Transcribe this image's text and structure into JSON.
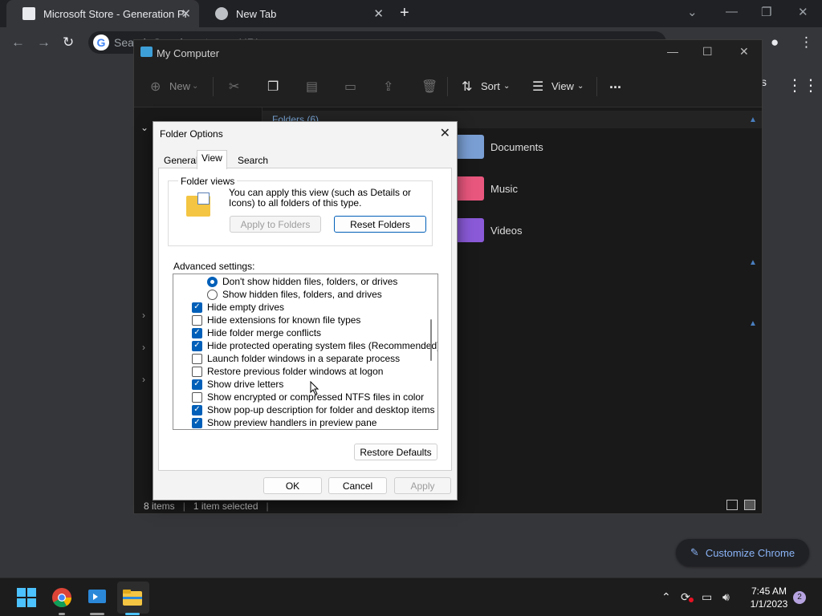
{
  "chrome": {
    "tabs": [
      {
        "title": "Microsoft Store - Generation Proj",
        "active": true
      },
      {
        "title": "New Tab",
        "active": false
      }
    ],
    "omnibox_placeholder": "Search Google or type a URL",
    "customize_label": "Customize Chrome",
    "partial_text": "s"
  },
  "explorer": {
    "title": "My Computer",
    "toolbar": {
      "new_label": "New",
      "sort_label": "Sort",
      "view_label": "View",
      "more_label": "..."
    },
    "folders_header": "Folders (6)",
    "items": [
      {
        "label": "Documents",
        "color": "#7a9fd4"
      },
      {
        "label": "Music",
        "color": "#e9577e"
      },
      {
        "label": "Videos",
        "color": "#8a5ad8"
      }
    ],
    "status": {
      "count": "8 items",
      "selected": "1 item selected"
    }
  },
  "dialog": {
    "title": "Folder Options",
    "tabs": [
      "General",
      "View",
      "Search"
    ],
    "active_tab": "View",
    "folder_views": {
      "label": "Folder views",
      "text": "You can apply this view (such as Details or Icons) to all folders of this type.",
      "apply_button": "Apply to Folders",
      "reset_button": "Reset Folders"
    },
    "advanced_label": "Advanced settings:",
    "advanced_items": [
      {
        "type": "radio",
        "label": "Don't show hidden files, folders, or drives",
        "checked": true,
        "indent": 1
      },
      {
        "type": "radio",
        "label": "Show hidden files, folders, and drives",
        "checked": false,
        "indent": 1
      },
      {
        "type": "check",
        "label": "Hide empty drives",
        "checked": true,
        "indent": 0
      },
      {
        "type": "check",
        "label": "Hide extensions for known file types",
        "checked": false,
        "indent": 0
      },
      {
        "type": "check",
        "label": "Hide folder merge conflicts",
        "checked": true,
        "indent": 0
      },
      {
        "type": "check",
        "label": "Hide protected operating system files (Recommended)",
        "checked": true,
        "indent": 0
      },
      {
        "type": "check",
        "label": "Launch folder windows in a separate process",
        "checked": false,
        "indent": 0
      },
      {
        "type": "check",
        "label": "Restore previous folder windows at logon",
        "checked": false,
        "indent": 0
      },
      {
        "type": "check",
        "label": "Show drive letters",
        "checked": true,
        "indent": 0
      },
      {
        "type": "check",
        "label": "Show encrypted or compressed NTFS files in color",
        "checked": false,
        "indent": 0
      },
      {
        "type": "check",
        "label": "Show pop-up description for folder and desktop items",
        "checked": true,
        "indent": 0
      },
      {
        "type": "check",
        "label": "Show preview handlers in preview pane",
        "checked": true,
        "indent": 0
      }
    ],
    "restore_defaults": "Restore Defaults",
    "ok": "OK",
    "cancel": "Cancel",
    "apply": "Apply"
  },
  "taskbar": {
    "time": "7:45 AM",
    "date": "1/1/2023",
    "notification_count": "2"
  }
}
